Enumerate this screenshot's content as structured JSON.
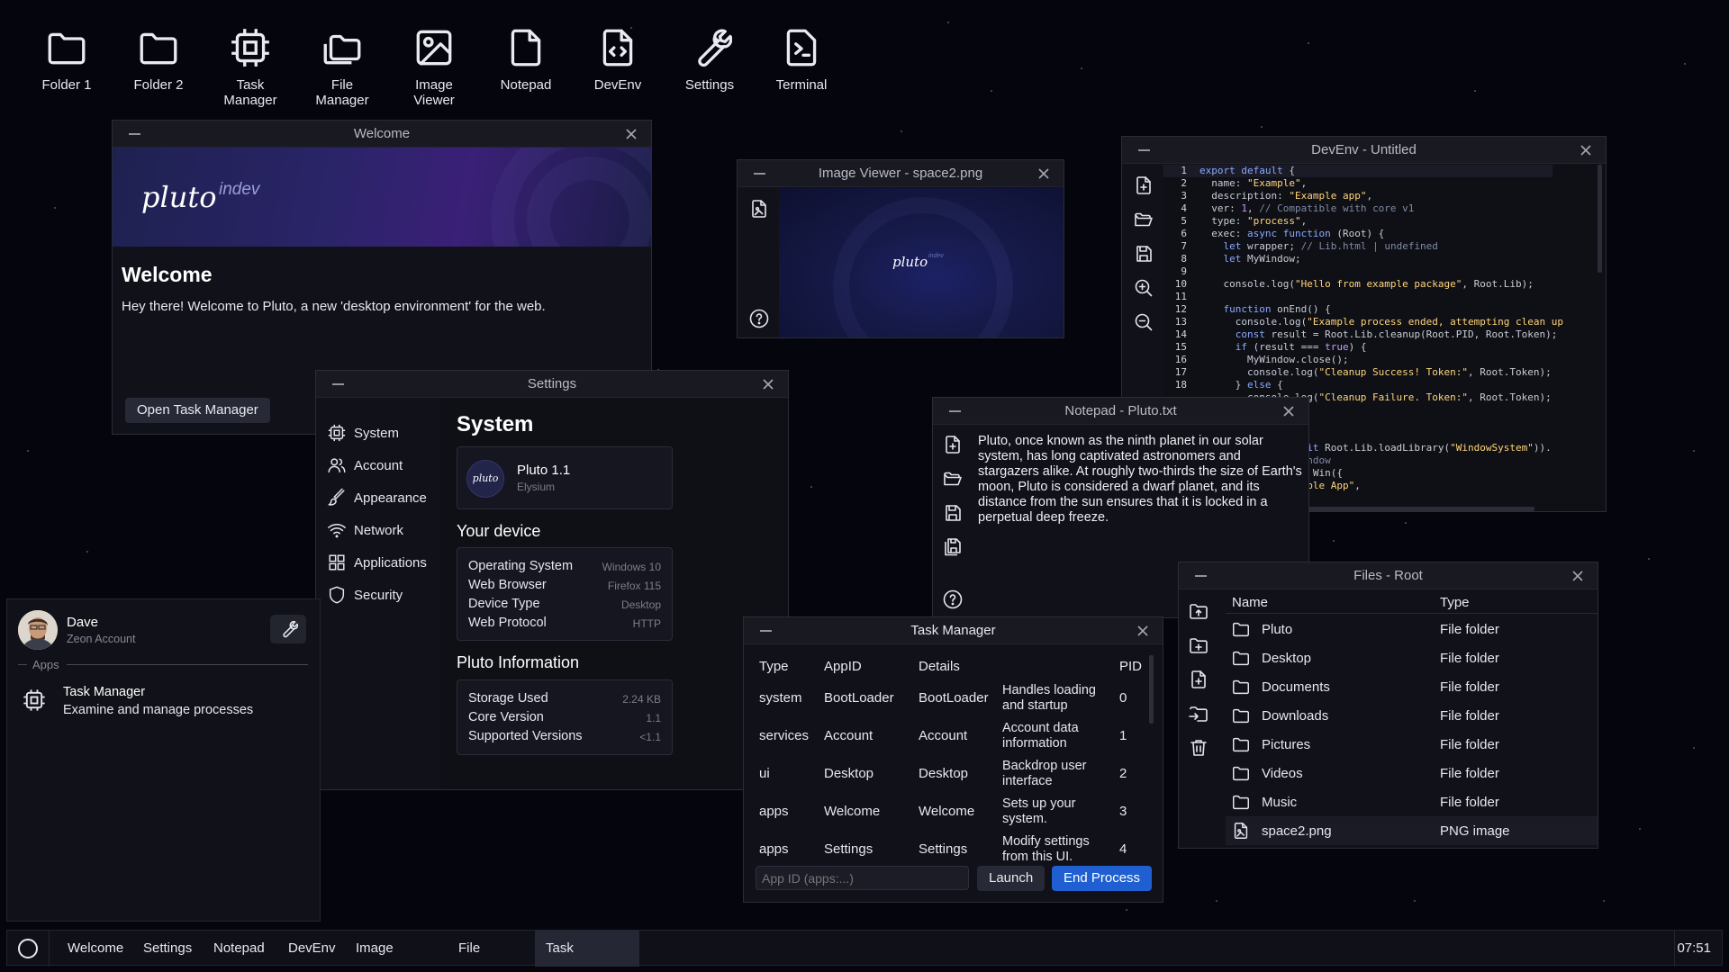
{
  "desktop_icons": [
    {
      "label": "Folder 1",
      "icon": "folder-icon"
    },
    {
      "label": "Folder 2",
      "icon": "folder-icon"
    },
    {
      "label": "Task\nManager",
      "icon": "cpu-icon"
    },
    {
      "label": "File\nManager",
      "icon": "files-icon"
    },
    {
      "label": "Image\nViewer",
      "icon": "image-icon"
    },
    {
      "label": "Notepad",
      "icon": "file-icon"
    },
    {
      "label": "DevEnv",
      "icon": "code-file-icon"
    },
    {
      "label": "Settings",
      "icon": "wrench-icon"
    },
    {
      "label": "Terminal",
      "icon": "terminal-icon"
    }
  ],
  "welcome": {
    "title": "Welcome",
    "brand": "pluto",
    "brand_sub": "indev",
    "heading": "Welcome",
    "body": "Hey there! Welcome to Pluto, a new 'desktop environment' for the web.",
    "button": "Open Task Manager"
  },
  "image_viewer": {
    "title": "Image Viewer - space2.png",
    "image_text": "pluto",
    "image_sub": "indev"
  },
  "devenv": {
    "title": "DevEnv - Untitled",
    "line_numbers": [
      "1",
      "2",
      "3",
      "4",
      "5",
      "6",
      "7",
      "8",
      "9",
      "10",
      "11",
      "12",
      "13",
      "14",
      "15",
      "16",
      "17",
      "18"
    ]
  },
  "settings": {
    "title": "Settings",
    "nav": [
      {
        "label": "System",
        "icon": "cpu-icon"
      },
      {
        "label": "Account",
        "icon": "users-icon"
      },
      {
        "label": "Appearance",
        "icon": "brush-icon"
      },
      {
        "label": "Network",
        "icon": "wifi-icon"
      },
      {
        "label": "Applications",
        "icon": "grid-icon"
      },
      {
        "label": "Security",
        "icon": "shield-icon"
      }
    ],
    "heading": "System",
    "version_name": "Pluto 1.1",
    "version_codename": "Elysium",
    "logo_text": "pluto",
    "device_heading": "Your device",
    "device_rows": [
      {
        "label": "Operating System",
        "value": "Windows 10"
      },
      {
        "label": "Web Browser",
        "value": "Firefox 115"
      },
      {
        "label": "Device Type",
        "value": "Desktop"
      },
      {
        "label": "Web Protocol",
        "value": "HTTP"
      }
    ],
    "info_heading": "Pluto Information",
    "info_rows": [
      {
        "label": "Storage Used",
        "value": "2.24 KB"
      },
      {
        "label": "Core Version",
        "value": "1.1"
      },
      {
        "label": "Supported Versions",
        "value": "<1.1"
      }
    ]
  },
  "notepad": {
    "title": "Notepad - Pluto.txt",
    "text": "Pluto, once known as the ninth planet in our solar system, has long captivated astronomers and stargazers alike. At roughly two-thirds the size of Earth's moon, Pluto is considered a dwarf planet, and its distance from the sun ensures that it is locked in a perpetual deep freeze."
  },
  "files": {
    "title": "Files - Root",
    "headers": {
      "name": "Name",
      "type": "Type"
    },
    "rows": [
      {
        "name": "Pluto",
        "type": "File folder",
        "icon": "folder-icon"
      },
      {
        "name": "Desktop",
        "type": "File folder",
        "icon": "folder-icon"
      },
      {
        "name": "Documents",
        "type": "File folder",
        "icon": "folder-icon"
      },
      {
        "name": "Downloads",
        "type": "File folder",
        "icon": "folder-icon"
      },
      {
        "name": "Pictures",
        "type": "File folder",
        "icon": "folder-icon"
      },
      {
        "name": "Videos",
        "type": "File folder",
        "icon": "folder-icon"
      },
      {
        "name": "Music",
        "type": "File folder",
        "icon": "folder-icon"
      },
      {
        "name": "space2.png",
        "type": "PNG image",
        "icon": "image-file-icon"
      }
    ]
  },
  "task_manager": {
    "title": "Task Manager",
    "headers": {
      "type": "Type",
      "appid": "AppID",
      "details": "Details",
      "pid": "PID"
    },
    "rows": [
      {
        "type": "system",
        "appid": "BootLoader",
        "details": "BootLoader",
        "desc": "Handles loading and startup",
        "pid": "0"
      },
      {
        "type": "services",
        "appid": "Account",
        "details": "Account",
        "desc": "Account data information",
        "pid": "1"
      },
      {
        "type": "ui",
        "appid": "Desktop",
        "details": "Desktop",
        "desc": "Backdrop user interface",
        "pid": "2"
      },
      {
        "type": "apps",
        "appid": "Welcome",
        "details": "Welcome",
        "desc": "Sets up your system.",
        "pid": "3"
      },
      {
        "type": "apps",
        "appid": "Settings",
        "details": "Settings",
        "desc": "Modify settings from this UI.",
        "pid": "4"
      }
    ],
    "input_placeholder": "App ID (apps:...)",
    "launch": "Launch",
    "end": "End Process"
  },
  "start_menu": {
    "user_name": "Dave",
    "user_sub": "Zeon Account",
    "apps_label": "Apps",
    "app_name": "Task Manager",
    "app_desc": "Examine and manage processes"
  },
  "taskbar": {
    "items": [
      "Welcome",
      "Settings",
      "Notepad",
      "DevEnv",
      "Image Viewer",
      "File Manager",
      "Task Manager"
    ],
    "active": "Task Manager",
    "clock": "07:51"
  }
}
